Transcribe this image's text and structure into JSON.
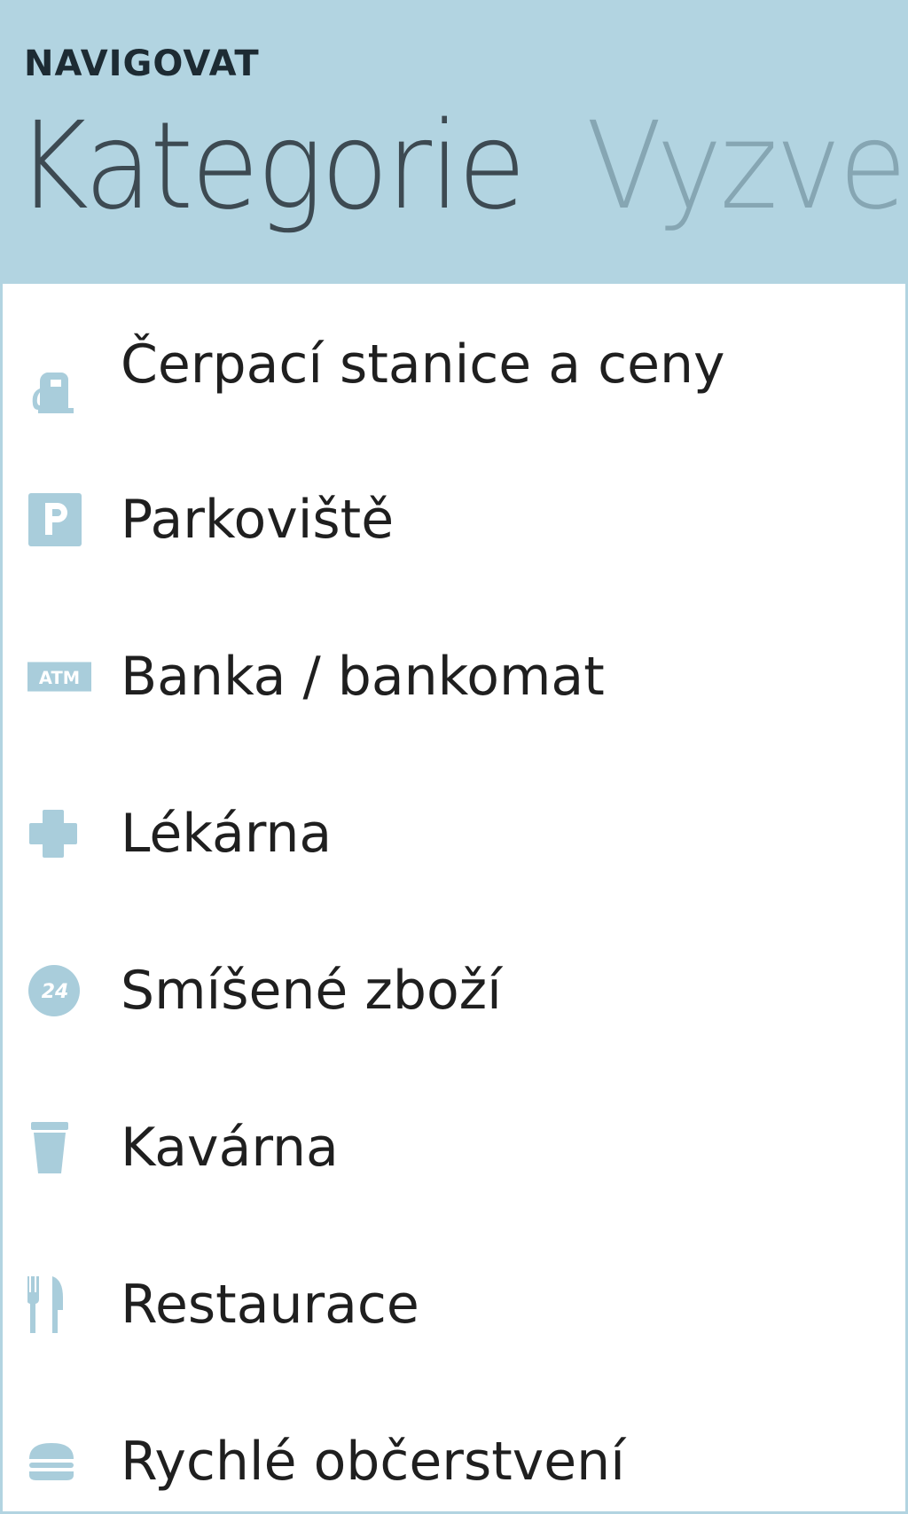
{
  "header": {
    "app_title": "NAVIGOVAT",
    "tabs": [
      {
        "label": "Kategorie",
        "active": true
      },
      {
        "label": "Vyzve",
        "active": false
      }
    ]
  },
  "categories": {
    "items": [
      {
        "label": "Čerpací stanice a ceny",
        "icon": "fuel-pump-icon"
      },
      {
        "label": "Parkoviště",
        "icon": "parking-icon"
      },
      {
        "label": "Banka / bankomat",
        "icon": "atm-icon",
        "icon_text": "ATM"
      },
      {
        "label": "Lékárna",
        "icon": "pharmacy-cross-icon"
      },
      {
        "label": "Smíšené zboží",
        "icon": "store-24-icon",
        "icon_text": "24"
      },
      {
        "label": "Kavárna",
        "icon": "coffee-cup-icon"
      },
      {
        "label": "Restaurace",
        "icon": "fork-knife-icon"
      },
      {
        "label": "Rychlé občerstvení",
        "icon": "burger-icon"
      }
    ]
  },
  "colors": {
    "header_bg": "#b2d4e1",
    "icon": "#a9cddb",
    "active_tab": "#3d4a52",
    "inactive_tab": "#86a6b3",
    "text": "#1f1f1f"
  }
}
